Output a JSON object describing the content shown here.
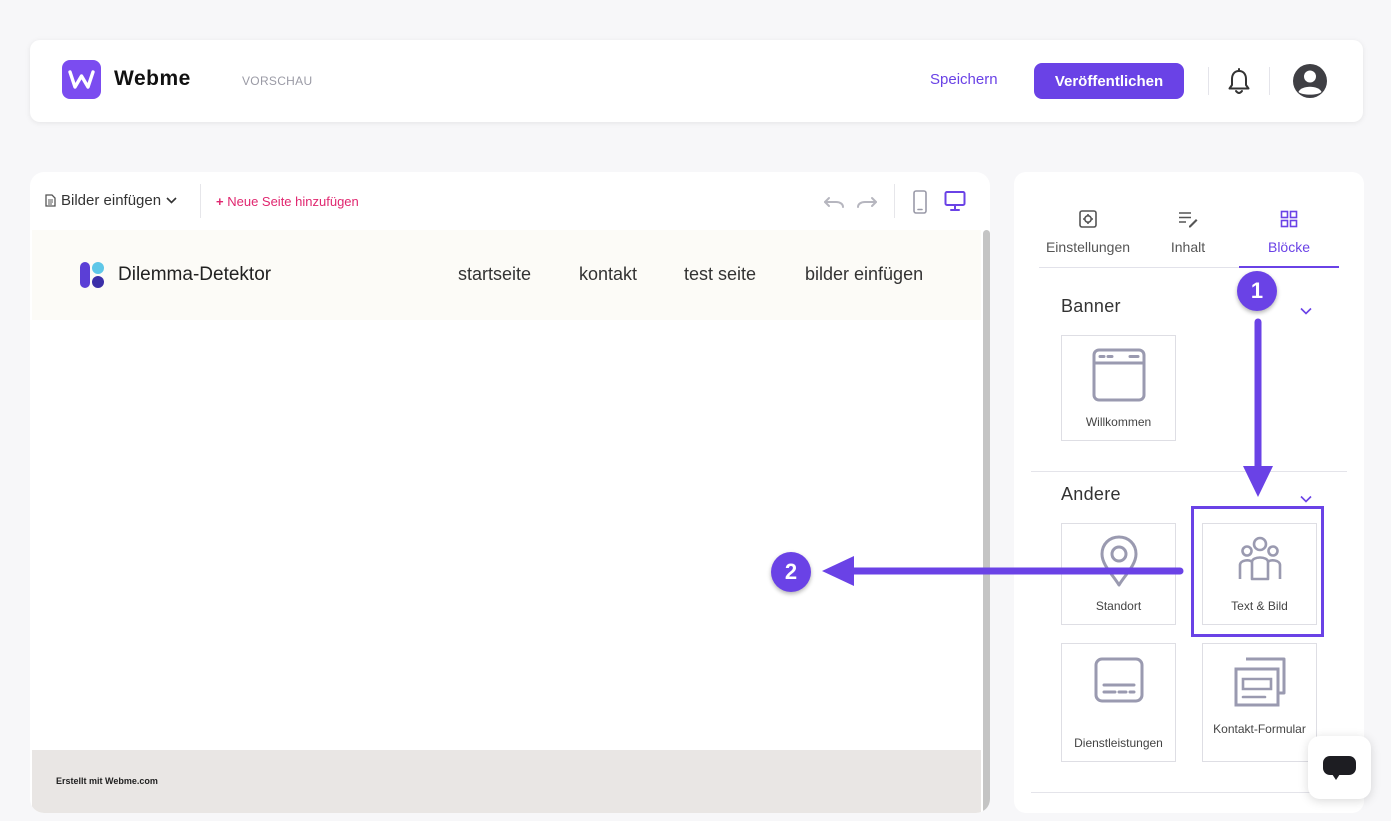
{
  "header": {
    "brand": "Webme",
    "mode": "VORSCHAU",
    "save_label": "Speichern",
    "publish_label": "Veröffentlichen"
  },
  "editor": {
    "page_select": "Bilder einfügen",
    "add_page": "Neue Seite hinzufügen",
    "add_page_plus": "+"
  },
  "site": {
    "name": "Dilemma-Detektor",
    "nav": [
      "startseite",
      "kontakt",
      "test seite",
      "bilder einfügen"
    ],
    "footer": "Erstellt mit Webme.com"
  },
  "panel": {
    "tabs": [
      "Einstellungen",
      "Inhalt",
      "Blöcke"
    ],
    "active_tab": "Blöcke",
    "sections": {
      "banner": {
        "title": "Banner",
        "blocks": [
          "Willkommen"
        ]
      },
      "andere": {
        "title": "Andere",
        "blocks": [
          "Standort",
          "Text & Bild",
          "Dienstleistungen",
          "Kontakt-Formular"
        ]
      }
    }
  },
  "annotations": {
    "step1": "1",
    "step2": "2"
  },
  "colors": {
    "accent": "#6a42e6",
    "add_page": "#e0266f",
    "logo_bg": "#7b4cf0"
  }
}
